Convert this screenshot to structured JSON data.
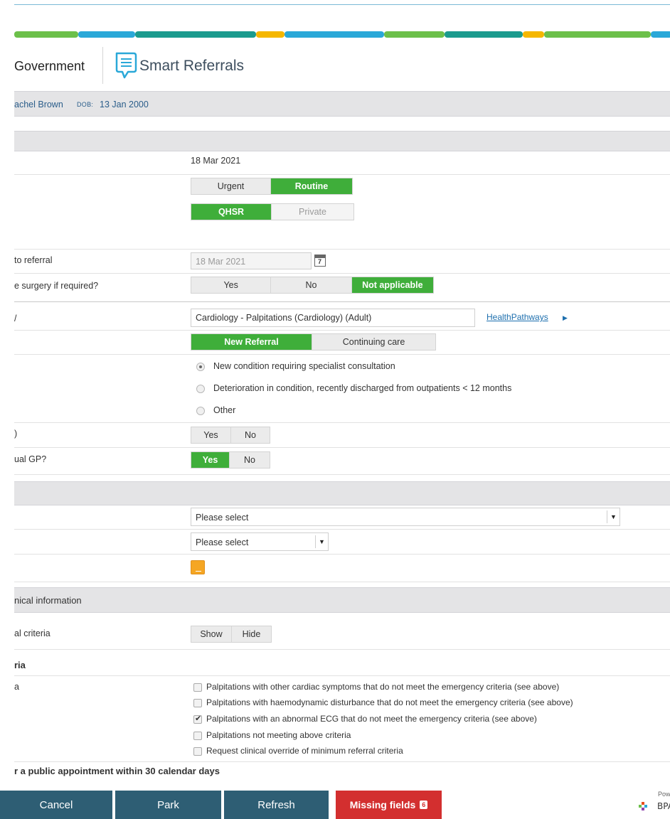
{
  "header": {
    "government_label": "Government",
    "app_title": "Smart Referrals"
  },
  "patient": {
    "name": "achel Brown",
    "dob_label": "DOB:",
    "dob": "13 Jan 2000"
  },
  "referral": {
    "date_value": "18 Mar 2021",
    "urgency": {
      "options": [
        "Urgent",
        "Routine"
      ],
      "selected": "Routine"
    },
    "funding": {
      "options": [
        "QHSR",
        "Private"
      ],
      "selected": "QHSR"
    },
    "date_row_label": "to referral",
    "date_input_value": "18 Mar 2021",
    "surgery_label": "e surgery if required?",
    "surgery": {
      "options": [
        "Yes",
        "No",
        "Not applicable"
      ],
      "selected": "Not applicable"
    },
    "specialty_label": "/",
    "specialty_value": "Cardiology - Palpitations (Cardiology) (Adult)",
    "healthpathways_link": "HealthPathways",
    "referral_type": {
      "options": [
        "New Referral",
        "Continuing care"
      ],
      "selected": "New Referral"
    },
    "reason_options": [
      "New condition requiring specialist consultation",
      "Deterioration in condition, recently discharged from outpatients < 12 months",
      "Other"
    ],
    "reason_selected": 0,
    "q1_label": ")",
    "q1": {
      "options": [
        "Yes",
        "No"
      ],
      "selected": ""
    },
    "q2_label": "ual GP?",
    "q2": {
      "options": [
        "Yes",
        "No"
      ],
      "selected": "Yes"
    }
  },
  "selects": {
    "select1_value": "Please select",
    "select2_value": "Please select"
  },
  "clinical": {
    "section_title": "nical information",
    "criteria_label": "al criteria",
    "criteria_toggle": [
      "Show",
      "Hide"
    ],
    "criteria_heading": "ria",
    "criteria_row_label": "a",
    "checkboxes": [
      {
        "label": "Palpitations with other cardiac symptoms that do not meet the emergency criteria (see above)",
        "checked": false
      },
      {
        "label": "Palpitations with haemodynamic disturbance that do not meet the emergency criteria (see above)",
        "checked": false
      },
      {
        "label": "Palpitations with an abnormal ECG that do not meet the emergency criteria (see above)",
        "checked": true
      },
      {
        "label": "Palpitations not meeting above criteria",
        "checked": false
      },
      {
        "label": "Request clinical override of minimum referral criteria",
        "checked": false
      }
    ],
    "appointment_note": "r a public appointment within 30 calendar days"
  },
  "footer": {
    "cancel": "Cancel",
    "park": "Park",
    "refresh": "Refresh",
    "missing_fields": "Missing fields",
    "missing_count": "6",
    "powered_by": "Powe",
    "bpac": "BPAC"
  },
  "colors": {
    "accent_green": "#3fae3a",
    "button_navy": "#2e5e74",
    "alert_red": "#d32f2f",
    "link_blue": "#1d6fae"
  }
}
